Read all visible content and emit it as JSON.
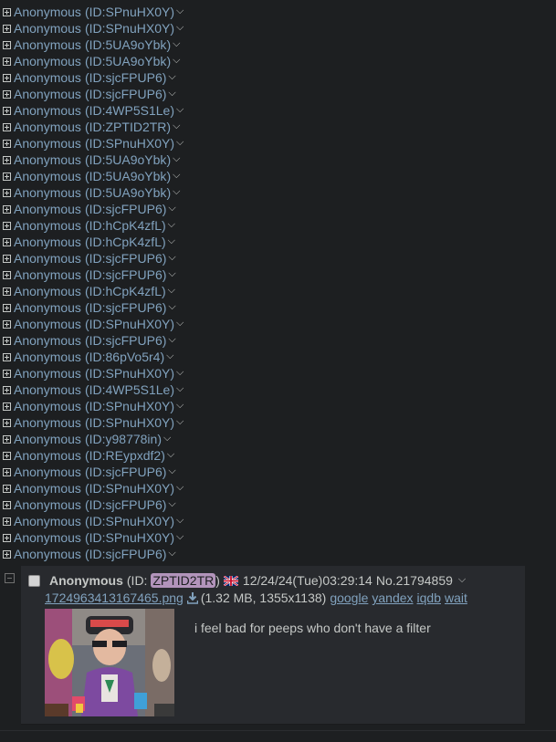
{
  "hidden_posts": [
    {
      "name": "Anonymous",
      "id": "SPnuHX0Y"
    },
    {
      "name": "Anonymous",
      "id": "SPnuHX0Y"
    },
    {
      "name": "Anonymous",
      "id": "5UA9oYbk"
    },
    {
      "name": "Anonymous",
      "id": "5UA9oYbk"
    },
    {
      "name": "Anonymous",
      "id": "sjcFPUP6"
    },
    {
      "name": "Anonymous",
      "id": "sjcFPUP6"
    },
    {
      "name": "Anonymous",
      "id": "4WP5S1Le"
    },
    {
      "name": "Anonymous",
      "id": "ZPTID2TR"
    },
    {
      "name": "Anonymous",
      "id": "SPnuHX0Y"
    },
    {
      "name": "Anonymous",
      "id": "5UA9oYbk"
    },
    {
      "name": "Anonymous",
      "id": "5UA9oYbk"
    },
    {
      "name": "Anonymous",
      "id": "5UA9oYbk"
    },
    {
      "name": "Anonymous",
      "id": "sjcFPUP6"
    },
    {
      "name": "Anonymous",
      "id": "hCpK4zfL"
    },
    {
      "name": "Anonymous",
      "id": "hCpK4zfL"
    },
    {
      "name": "Anonymous",
      "id": "sjcFPUP6"
    },
    {
      "name": "Anonymous",
      "id": "sjcFPUP6"
    },
    {
      "name": "Anonymous",
      "id": "hCpK4zfL"
    },
    {
      "name": "Anonymous",
      "id": "sjcFPUP6"
    },
    {
      "name": "Anonymous",
      "id": "SPnuHX0Y"
    },
    {
      "name": "Anonymous",
      "id": "sjcFPUP6"
    },
    {
      "name": "Anonymous",
      "id": "86pVo5r4"
    },
    {
      "name": "Anonymous",
      "id": "SPnuHX0Y"
    },
    {
      "name": "Anonymous",
      "id": "4WP5S1Le"
    },
    {
      "name": "Anonymous",
      "id": "SPnuHX0Y"
    },
    {
      "name": "Anonymous",
      "id": "SPnuHX0Y"
    },
    {
      "name": "Anonymous",
      "id": "y98778in"
    },
    {
      "name": "Anonymous",
      "id": "REypxdf2"
    },
    {
      "name": "Anonymous",
      "id": "sjcFPUP6"
    },
    {
      "name": "Anonymous",
      "id": "SPnuHX0Y"
    },
    {
      "name": "Anonymous",
      "id": "sjcFPUP6"
    },
    {
      "name": "Anonymous",
      "id": "SPnuHX0Y"
    },
    {
      "name": "Anonymous",
      "id": "SPnuHX0Y"
    },
    {
      "name": "Anonymous",
      "id": "sjcFPUP6"
    }
  ],
  "post": {
    "name": "Anonymous",
    "id_prefix": "(ID: ",
    "id": "ZPTID2TR",
    "id_suffix": ")",
    "flag": "uk-flag-icon",
    "datetime": "12/24/24(Tue)03:29:14",
    "number": "No.21794859",
    "file_name": "1724963413167465.png",
    "file_info": "(1.32 MB, 1355x1138)",
    "links": [
      "google",
      "yandex",
      "iqdb",
      "wait"
    ],
    "comment": "i feel bad for peeps who don't have a filter"
  },
  "colors": {
    "background": "#1d1f21",
    "post_background": "#282a2e",
    "link": "#81a2be",
    "text": "#c5c8c6",
    "id_highlight": "#b294bb"
  }
}
